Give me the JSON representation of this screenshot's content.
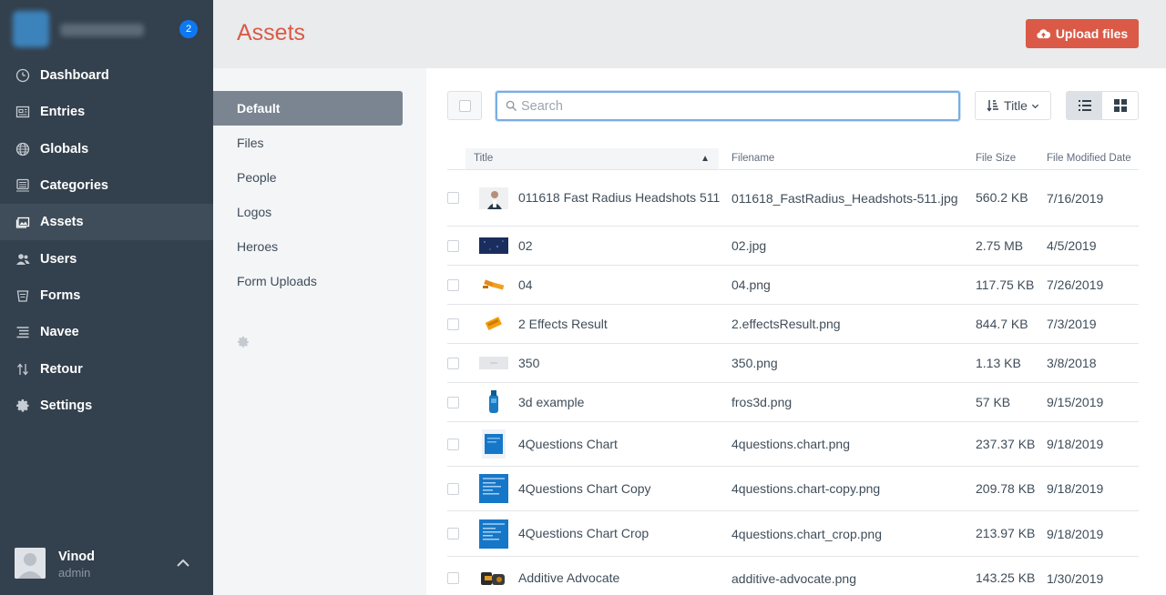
{
  "app": {
    "job_badge": "2"
  },
  "nav": {
    "items": [
      {
        "label": "Dashboard",
        "icon": "gauge-icon"
      },
      {
        "label": "Entries",
        "icon": "newspaper-icon"
      },
      {
        "label": "Globals",
        "icon": "globe-icon"
      },
      {
        "label": "Categories",
        "icon": "sitemap-icon"
      },
      {
        "label": "Assets",
        "icon": "image-icon",
        "active": true
      },
      {
        "label": "Users",
        "icon": "users-icon"
      },
      {
        "label": "Forms",
        "icon": "form-icon"
      },
      {
        "label": "Navee",
        "icon": "list-icon"
      },
      {
        "label": "Retour",
        "icon": "redirect-icon"
      },
      {
        "label": "Settings",
        "icon": "gear-icon"
      }
    ]
  },
  "user": {
    "name": "Vinod",
    "role": "admin"
  },
  "header": {
    "title": "Assets",
    "upload_label": "Upload files"
  },
  "sources": {
    "items": [
      "Default",
      "Files",
      "People",
      "Logos",
      "Heroes",
      "Form Uploads"
    ],
    "active": "Default"
  },
  "toolbar": {
    "search_placeholder": "Search",
    "search_value": "",
    "sort_label": "Title",
    "view_mode": "table"
  },
  "table": {
    "columns": {
      "title": "Title",
      "filename": "Filename",
      "size": "File Size",
      "date": "File Modified Date"
    },
    "sort_direction": "ascending",
    "rows": [
      {
        "title": "011618 Fast Radius Headshots 511",
        "filename": "011618_FastRadius_Headshots-511.jpg",
        "size": "560.2 KB",
        "date": "7/16/2019",
        "thumb": "headshot",
        "height": 62
      },
      {
        "title": "02",
        "filename": "02.jpg",
        "size": "2.75 MB",
        "date": "4/5/2019",
        "thumb": "dark-blue",
        "height": 43
      },
      {
        "title": "04",
        "filename": "04.png",
        "size": "117.75 KB",
        "date": "7/26/2019",
        "thumb": "orange-bars",
        "height": 43
      },
      {
        "title": "2 Effects Result",
        "filename": "2.effectsResult.png",
        "size": "844.7 KB",
        "date": "7/3/2019",
        "thumb": "orange-block",
        "height": 43
      },
      {
        "title": "350",
        "filename": "350.png",
        "size": "1.13 KB",
        "date": "3/8/2018",
        "thumb": "grey",
        "height": 43
      },
      {
        "title": "3d example",
        "filename": "fros3d.png",
        "size": "57 KB",
        "date": "9/15/2019",
        "thumb": "blue-bottle",
        "height": 43
      },
      {
        "title": "4Questions Chart",
        "filename": "4questions.chart.png",
        "size": "237.37 KB",
        "date": "9/18/2019",
        "thumb": "blue-doc-small",
        "height": 49
      },
      {
        "title": "4Questions Chart Copy",
        "filename": "4questions.chart-copy.png",
        "size": "209.78 KB",
        "date": "9/18/2019",
        "thumb": "blue-doc",
        "height": 49
      },
      {
        "title": "4Questions Chart Crop",
        "filename": "4questions.chart_crop.png",
        "size": "213.97 KB",
        "date": "9/18/2019",
        "thumb": "blue-doc",
        "height": 50
      },
      {
        "title": "Additive Advocate",
        "filename": "additive-advocate.png",
        "size": "143.25 KB",
        "date": "1/30/2019",
        "thumb": "dark-parts",
        "height": 48
      }
    ]
  }
}
